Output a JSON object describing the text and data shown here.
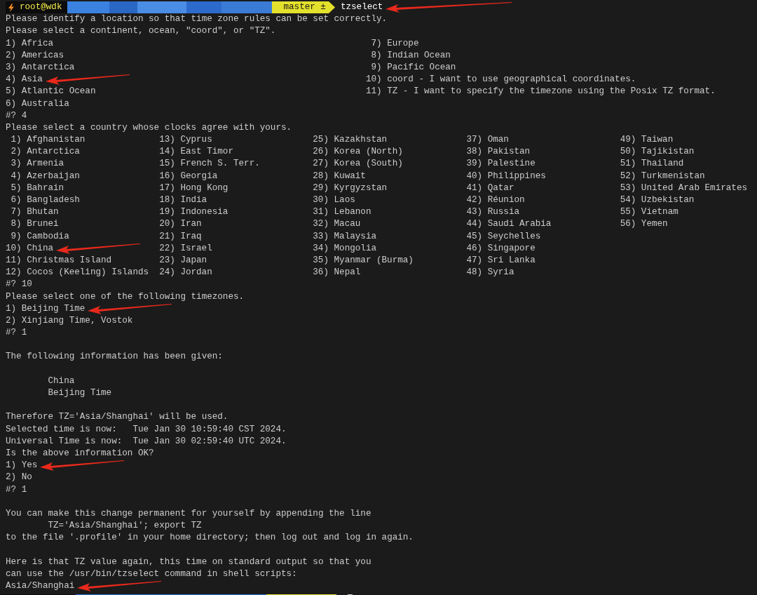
{
  "prompt": {
    "user": "root@wdk",
    "branch": "master ±",
    "command": "tzselect",
    "arrow": true
  },
  "blocks": [
    {
      "kind": "text",
      "text": "Please identify a location so that time zone rules can be set correctly.",
      "arrow": false
    },
    {
      "kind": "text",
      "text": "Please select a continent, ocean, \"coord\", or \"TZ\".",
      "arrow": false
    },
    {
      "kind": "columns",
      "columns": [
        [
          {
            "text": "1) Africa",
            "arrow": false
          },
          {
            "text": "2) Americas",
            "arrow": false
          },
          {
            "text": "3) Antarctica",
            "arrow": false
          },
          {
            "text": "4) Asia",
            "arrow": true
          },
          {
            "text": "5) Atlantic Ocean",
            "arrow": false
          },
          {
            "text": "6) Australia",
            "arrow": false
          }
        ],
        [
          {
            "text": " 7) Europe",
            "arrow": false
          },
          {
            "text": " 8) Indian Ocean",
            "arrow": false
          },
          {
            "text": " 9) Pacific Ocean",
            "arrow": false
          },
          {
            "text": "10) coord - I want to use geographical coordinates.",
            "arrow": false
          },
          {
            "text": "11) TZ - I want to specify the timezone using the Posix TZ format.",
            "arrow": false
          }
        ]
      ]
    },
    {
      "kind": "text",
      "text": "#? 4",
      "arrow": false
    },
    {
      "kind": "text",
      "text": "Please select a country whose clocks agree with yours.",
      "arrow": false
    },
    {
      "kind": "columns",
      "columns": [
        [
          {
            "text": " 1) Afghanistan",
            "arrow": false
          },
          {
            "text": " 2) Antarctica",
            "arrow": false
          },
          {
            "text": " 3) Armenia",
            "arrow": false
          },
          {
            "text": " 4) Azerbaijan",
            "arrow": false
          },
          {
            "text": " 5) Bahrain",
            "arrow": false
          },
          {
            "text": " 6) Bangladesh",
            "arrow": false
          },
          {
            "text": " 7) Bhutan",
            "arrow": false
          },
          {
            "text": " 8) Brunei",
            "arrow": false
          },
          {
            "text": " 9) Cambodia",
            "arrow": false
          },
          {
            "text": "10) China",
            "arrow": true
          },
          {
            "text": "11) Christmas Island",
            "arrow": false
          },
          {
            "text": "12) Cocos (Keeling) Islands",
            "arrow": false
          }
        ],
        [
          {
            "text": "13) Cyprus",
            "arrow": false
          },
          {
            "text": "14) East Timor",
            "arrow": false
          },
          {
            "text": "15) French S. Terr.",
            "arrow": false
          },
          {
            "text": "16) Georgia",
            "arrow": false
          },
          {
            "text": "17) Hong Kong",
            "arrow": false
          },
          {
            "text": "18) India",
            "arrow": false
          },
          {
            "text": "19) Indonesia",
            "arrow": false
          },
          {
            "text": "20) Iran",
            "arrow": false
          },
          {
            "text": "21) Iraq",
            "arrow": false
          },
          {
            "text": "22) Israel",
            "arrow": false
          },
          {
            "text": "23) Japan",
            "arrow": false
          },
          {
            "text": "24) Jordan",
            "arrow": false
          }
        ],
        [
          {
            "text": "25) Kazakhstan",
            "arrow": false
          },
          {
            "text": "26) Korea (North)",
            "arrow": false
          },
          {
            "text": "27) Korea (South)",
            "arrow": false
          },
          {
            "text": "28) Kuwait",
            "arrow": false
          },
          {
            "text": "29) Kyrgyzstan",
            "arrow": false
          },
          {
            "text": "30) Laos",
            "arrow": false
          },
          {
            "text": "31) Lebanon",
            "arrow": false
          },
          {
            "text": "32) Macau",
            "arrow": false
          },
          {
            "text": "33) Malaysia",
            "arrow": false
          },
          {
            "text": "34) Mongolia",
            "arrow": false
          },
          {
            "text": "35) Myanmar (Burma)",
            "arrow": false
          },
          {
            "text": "36) Nepal",
            "arrow": false
          }
        ],
        [
          {
            "text": "37) Oman",
            "arrow": false
          },
          {
            "text": "38) Pakistan",
            "arrow": false
          },
          {
            "text": "39) Palestine",
            "arrow": false
          },
          {
            "text": "40) Philippines",
            "arrow": false
          },
          {
            "text": "41) Qatar",
            "arrow": false
          },
          {
            "text": "42) Réunion",
            "arrow": false
          },
          {
            "text": "43) Russia",
            "arrow": false
          },
          {
            "text": "44) Saudi Arabia",
            "arrow": false
          },
          {
            "text": "45) Seychelles",
            "arrow": false
          },
          {
            "text": "46) Singapore",
            "arrow": false
          },
          {
            "text": "47) Sri Lanka",
            "arrow": false
          },
          {
            "text": "48) Syria",
            "arrow": false
          }
        ],
        [
          {
            "text": "49) Taiwan",
            "arrow": false
          },
          {
            "text": "50) Tajikistan",
            "arrow": false
          },
          {
            "text": "51) Thailand",
            "arrow": false
          },
          {
            "text": "52) Turkmenistan",
            "arrow": false
          },
          {
            "text": "53) United Arab Emirates",
            "arrow": false
          },
          {
            "text": "54) Uzbekistan",
            "arrow": false
          },
          {
            "text": "55) Vietnam",
            "arrow": false
          },
          {
            "text": "56) Yemen",
            "arrow": false
          }
        ]
      ]
    },
    {
      "kind": "text",
      "text": "#? 10",
      "arrow": false
    },
    {
      "kind": "text",
      "text": "Please select one of the following timezones.",
      "arrow": false
    },
    {
      "kind": "text",
      "text": "1) Beijing Time",
      "arrow": true
    },
    {
      "kind": "text",
      "text": "2) Xinjiang Time, Vostok",
      "arrow": false
    },
    {
      "kind": "text",
      "text": "#? 1",
      "arrow": false
    },
    {
      "kind": "blank"
    },
    {
      "kind": "text",
      "text": "The following information has been given:",
      "arrow": false
    },
    {
      "kind": "blank"
    },
    {
      "kind": "text",
      "text": "        China",
      "arrow": false
    },
    {
      "kind": "text",
      "text": "        Beijing Time",
      "arrow": false
    },
    {
      "kind": "blank"
    },
    {
      "kind": "text",
      "text": "Therefore TZ='Asia/Shanghai' will be used.",
      "arrow": false
    },
    {
      "kind": "text",
      "text": "Selected time is now:   Tue Jan 30 10:59:40 CST 2024.",
      "arrow": false
    },
    {
      "kind": "text",
      "text": "Universal Time is now:  Tue Jan 30 02:59:40 UTC 2024.",
      "arrow": false
    },
    {
      "kind": "text",
      "text": "Is the above information OK?",
      "arrow": false
    },
    {
      "kind": "text",
      "text": "1) Yes",
      "arrow": true
    },
    {
      "kind": "text",
      "text": "2) No",
      "arrow": false
    },
    {
      "kind": "text",
      "text": "#? 1",
      "arrow": false
    },
    {
      "kind": "blank"
    },
    {
      "kind": "text",
      "text": "You can make this change permanent for yourself by appending the line",
      "arrow": false
    },
    {
      "kind": "text",
      "text": "        TZ='Asia/Shanghai'; export TZ",
      "arrow": false
    },
    {
      "kind": "text",
      "text": "to the file '.profile' in your home directory; then log out and log in again.",
      "arrow": false
    },
    {
      "kind": "blank"
    },
    {
      "kind": "text",
      "text": "Here is that TZ value again, this time on standard output so that you",
      "arrow": false
    },
    {
      "kind": "text",
      "text": "can use the /usr/bin/tzselect command in shell scripts:",
      "arrow": false
    },
    {
      "kind": "text",
      "text": "Asia/Shanghai",
      "arrow": true
    },
    {
      "kind": "prompt-sliver"
    }
  ]
}
